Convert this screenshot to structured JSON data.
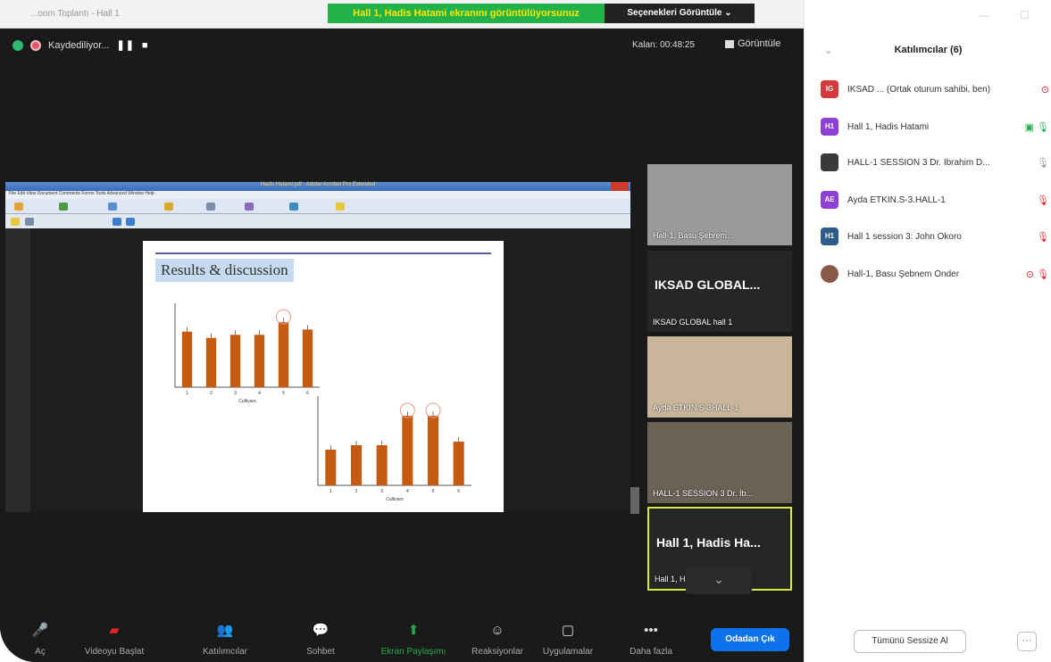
{
  "window": {
    "title": "...oom Toplantı - Hall 1"
  },
  "share_banner": "Hall 1, Hadis Hatami ekranını görüntülüyorsunuz",
  "view_options": "Seçenekleri Görüntüle ⌄",
  "recording": {
    "label": "Kaydediliyor...",
    "pause": "❚❚",
    "stop": "■"
  },
  "timer": "Kalan: 00:48:25",
  "view_button": "Görüntüle",
  "acrobat": {
    "title": "Hadis Hatami.pdf - Adobe Acrobat Pro Extended",
    "menu": "File  Edit  View  Document  Comments  Forms  Tools  Advanced  Window  Help"
  },
  "slide": {
    "title": "Results & discussion"
  },
  "chart_data": [
    {
      "type": "bar",
      "categories": [
        "1",
        "2",
        "3",
        "4",
        "5",
        "6"
      ],
      "values": [
        5.3,
        4.7,
        5.0,
        5.0,
        6.2,
        5.5
      ],
      "ylim": [
        0,
        8
      ],
      "xlabel": "Cultivars",
      "ylabel": "",
      "color": "#c55a11",
      "highlighted": [
        5
      ]
    },
    {
      "type": "bar",
      "categories": [
        "1",
        "2",
        "3",
        "4",
        "5",
        "6"
      ],
      "values": [
        4.0,
        4.5,
        4.5,
        7.8,
        7.8,
        4.9
      ],
      "ylim": [
        0,
        10
      ],
      "xlabel": "Cultivars",
      "ylabel": "",
      "color": "#c55a11",
      "highlighted": [
        4,
        5
      ]
    }
  ],
  "thumbnails": [
    {
      "label": "Hall-1, Basu Şebrem...",
      "bg": "#9a9a9a"
    },
    {
      "label": "IKSAD GLOBAL hall 1",
      "big": "IKSAD  GLOBAL...",
      "bg": "#262626"
    },
    {
      "label": "Ayda ETKIN.S-3HALL-1",
      "bg": "#c9b59a"
    },
    {
      "label": "HALL-1 SESSION 3 Dr. İb...",
      "bg": "#6b6256"
    },
    {
      "label": "Hall 1, Hadis Hatami",
      "big": "Hall 1, Hadis Ha...",
      "bg": "#1e1e1e"
    }
  ],
  "toolbar": [
    {
      "label": "Aç",
      "icon": "🎤"
    },
    {
      "label": "Videoyu Başlat",
      "icon": "▰"
    },
    {
      "label": "Katılımcılar",
      "icon": "👥"
    },
    {
      "label": "Sohbet",
      "icon": "💬"
    },
    {
      "label": "Ekran Paylaşımı",
      "icon": "⬆"
    },
    {
      "label": "Reaksiyonlar",
      "icon": "☺"
    },
    {
      "label": "Uygulamalar",
      "icon": "▢"
    },
    {
      "label": "Daha fazla",
      "icon": "•••"
    }
  ],
  "leave": "Odadan Çık",
  "panel": {
    "title": "Katılımcılar (6)",
    "participants": [
      {
        "initials": "IG",
        "color": "#d33a3a",
        "name": "IKSAD ... (Ortak oturum sahibi, ben)",
        "icon": "⊙",
        "icon_color": "#e0242a"
      },
      {
        "initials": "H1",
        "color": "#8e3fd6",
        "name": "Hall 1, Hadis Hatami",
        "icon": "▣ 🎙",
        "icon_color": "#1fae4b"
      },
      {
        "initials": "",
        "color": "#3a3a3a",
        "name": "HALL-1 SESSION 3 Dr. İbrahim D...",
        "icon": "🎙",
        "icon_color": "#999"
      },
      {
        "initials": "AE",
        "color": "#8e3fd6",
        "name": "Ayda ETKİN.S-3.HALL-1",
        "icon": "🎙",
        "icon_color": "#e0242a"
      },
      {
        "initials": "H1",
        "color": "#2d5b8a",
        "name": "Hall 1 session 3: John Okoro",
        "icon": "🎙",
        "icon_color": "#e0242a"
      },
      {
        "initials": "",
        "color": "#8a5a48",
        "name": "Hall-1, Basu Şebnem Önder",
        "icon": "⊙ 🎙",
        "icon_color": "#e0242a"
      }
    ],
    "mute_all": "Tümünü Sessize Al",
    "more": "···"
  }
}
